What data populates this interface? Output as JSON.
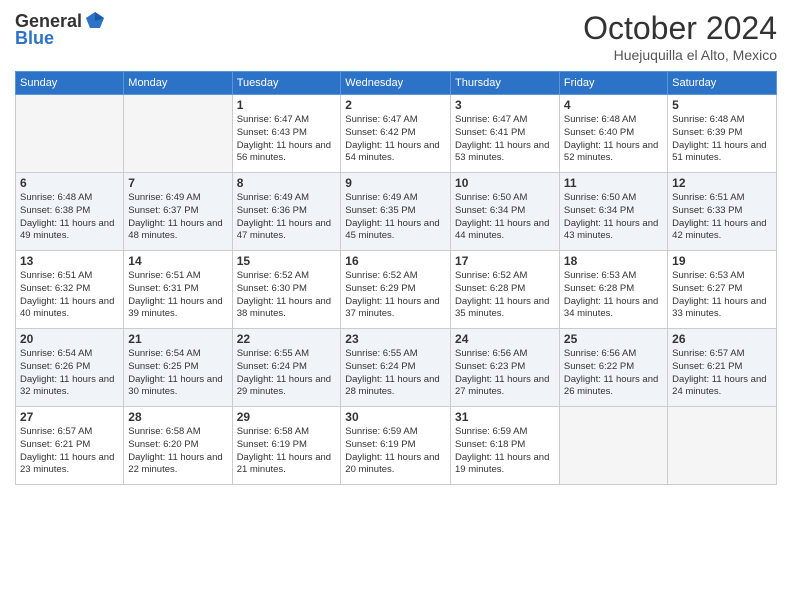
{
  "logo": {
    "general": "General",
    "blue": "Blue"
  },
  "title": "October 2024",
  "subtitle": "Huejuquilla el Alto, Mexico",
  "days_header": [
    "Sunday",
    "Monday",
    "Tuesday",
    "Wednesday",
    "Thursday",
    "Friday",
    "Saturday"
  ],
  "weeks": [
    [
      {
        "day": "",
        "empty": true
      },
      {
        "day": "",
        "empty": true
      },
      {
        "day": "1",
        "sunrise": "6:47 AM",
        "sunset": "6:43 PM",
        "daylight": "11 hours and 56 minutes."
      },
      {
        "day": "2",
        "sunrise": "6:47 AM",
        "sunset": "6:42 PM",
        "daylight": "11 hours and 54 minutes."
      },
      {
        "day": "3",
        "sunrise": "6:47 AM",
        "sunset": "6:41 PM",
        "daylight": "11 hours and 53 minutes."
      },
      {
        "day": "4",
        "sunrise": "6:48 AM",
        "sunset": "6:40 PM",
        "daylight": "11 hours and 52 minutes."
      },
      {
        "day": "5",
        "sunrise": "6:48 AM",
        "sunset": "6:39 PM",
        "daylight": "11 hours and 51 minutes."
      }
    ],
    [
      {
        "day": "6",
        "sunrise": "6:48 AM",
        "sunset": "6:38 PM",
        "daylight": "11 hours and 49 minutes."
      },
      {
        "day": "7",
        "sunrise": "6:49 AM",
        "sunset": "6:37 PM",
        "daylight": "11 hours and 48 minutes."
      },
      {
        "day": "8",
        "sunrise": "6:49 AM",
        "sunset": "6:36 PM",
        "daylight": "11 hours and 47 minutes."
      },
      {
        "day": "9",
        "sunrise": "6:49 AM",
        "sunset": "6:35 PM",
        "daylight": "11 hours and 45 minutes."
      },
      {
        "day": "10",
        "sunrise": "6:50 AM",
        "sunset": "6:34 PM",
        "daylight": "11 hours and 44 minutes."
      },
      {
        "day": "11",
        "sunrise": "6:50 AM",
        "sunset": "6:34 PM",
        "daylight": "11 hours and 43 minutes."
      },
      {
        "day": "12",
        "sunrise": "6:51 AM",
        "sunset": "6:33 PM",
        "daylight": "11 hours and 42 minutes."
      }
    ],
    [
      {
        "day": "13",
        "sunrise": "6:51 AM",
        "sunset": "6:32 PM",
        "daylight": "11 hours and 40 minutes."
      },
      {
        "day": "14",
        "sunrise": "6:51 AM",
        "sunset": "6:31 PM",
        "daylight": "11 hours and 39 minutes."
      },
      {
        "day": "15",
        "sunrise": "6:52 AM",
        "sunset": "6:30 PM",
        "daylight": "11 hours and 38 minutes."
      },
      {
        "day": "16",
        "sunrise": "6:52 AM",
        "sunset": "6:29 PM",
        "daylight": "11 hours and 37 minutes."
      },
      {
        "day": "17",
        "sunrise": "6:52 AM",
        "sunset": "6:28 PM",
        "daylight": "11 hours and 35 minutes."
      },
      {
        "day": "18",
        "sunrise": "6:53 AM",
        "sunset": "6:28 PM",
        "daylight": "11 hours and 34 minutes."
      },
      {
        "day": "19",
        "sunrise": "6:53 AM",
        "sunset": "6:27 PM",
        "daylight": "11 hours and 33 minutes."
      }
    ],
    [
      {
        "day": "20",
        "sunrise": "6:54 AM",
        "sunset": "6:26 PM",
        "daylight": "11 hours and 32 minutes."
      },
      {
        "day": "21",
        "sunrise": "6:54 AM",
        "sunset": "6:25 PM",
        "daylight": "11 hours and 30 minutes."
      },
      {
        "day": "22",
        "sunrise": "6:55 AM",
        "sunset": "6:24 PM",
        "daylight": "11 hours and 29 minutes."
      },
      {
        "day": "23",
        "sunrise": "6:55 AM",
        "sunset": "6:24 PM",
        "daylight": "11 hours and 28 minutes."
      },
      {
        "day": "24",
        "sunrise": "6:56 AM",
        "sunset": "6:23 PM",
        "daylight": "11 hours and 27 minutes."
      },
      {
        "day": "25",
        "sunrise": "6:56 AM",
        "sunset": "6:22 PM",
        "daylight": "11 hours and 26 minutes."
      },
      {
        "day": "26",
        "sunrise": "6:57 AM",
        "sunset": "6:21 PM",
        "daylight": "11 hours and 24 minutes."
      }
    ],
    [
      {
        "day": "27",
        "sunrise": "6:57 AM",
        "sunset": "6:21 PM",
        "daylight": "11 hours and 23 minutes."
      },
      {
        "day": "28",
        "sunrise": "6:58 AM",
        "sunset": "6:20 PM",
        "daylight": "11 hours and 22 minutes."
      },
      {
        "day": "29",
        "sunrise": "6:58 AM",
        "sunset": "6:19 PM",
        "daylight": "11 hours and 21 minutes."
      },
      {
        "day": "30",
        "sunrise": "6:59 AM",
        "sunset": "6:19 PM",
        "daylight": "11 hours and 20 minutes."
      },
      {
        "day": "31",
        "sunrise": "6:59 AM",
        "sunset": "6:18 PM",
        "daylight": "11 hours and 19 minutes."
      },
      {
        "day": "",
        "empty": true
      },
      {
        "day": "",
        "empty": true
      }
    ]
  ]
}
